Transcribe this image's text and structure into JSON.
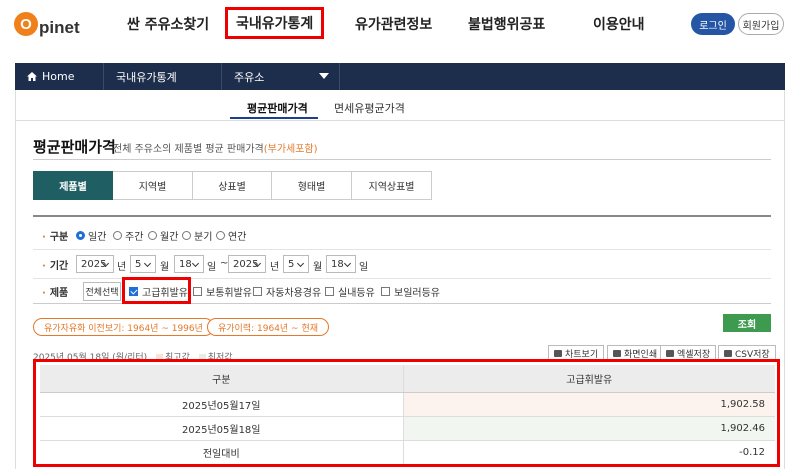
{
  "header": {
    "logo_letter": "O",
    "logo_text": "pinet",
    "nav": [
      "싼 주유소찾기",
      "국내유가통계",
      "유가관련정보",
      "불법행위공표",
      "이용안내"
    ],
    "login": "로그인",
    "join": "회원가입"
  },
  "subbar": {
    "home": "Home",
    "section": "국내유가통계",
    "dropdown": "주유소"
  },
  "subtabs": [
    "평균판매가격",
    "면세유평균가격"
  ],
  "page": {
    "title": "평균판매가격",
    "desc": "전체 주유소의 제품별 평균 판매가격",
    "desc_note": "(부가세포함)"
  },
  "tabs": [
    "제품별",
    "지역별",
    "상표별",
    "형태별",
    "지역상표별"
  ],
  "filters": {
    "period_label": "구분",
    "period_options": [
      "일간",
      "주간",
      "월간",
      "분기",
      "연간"
    ],
    "period_selected": "일간",
    "range_label": "기간",
    "from": {
      "year": "2025",
      "month": "5",
      "day": "18"
    },
    "to": {
      "year": "2025",
      "month": "5",
      "day": "18"
    },
    "unit_year": "년",
    "unit_month": "월",
    "unit_day": "일",
    "tilde": "~",
    "product_label": "제품",
    "select_all": "전체선택",
    "products": [
      {
        "name": "고급휘발유",
        "checked": true
      },
      {
        "name": "보통휘발유",
        "checked": false
      },
      {
        "name": "자동차용경유",
        "checked": false
      },
      {
        "name": "실내등유",
        "checked": false
      },
      {
        "name": "보일러등유",
        "checked": false
      }
    ]
  },
  "links": {
    "history1": "유가자유화 이전보기: 1964년 ~ 1996년",
    "history2": "유가이력: 1964년 ~ 현재"
  },
  "search_button": "조회",
  "meta": {
    "date": "2025년 05월 18일 (원/리터)",
    "legend_high": "최고값",
    "legend_low": "최저값"
  },
  "actions": [
    "차트보기",
    "화면인쇄",
    "엑셀저장",
    "CSV저장"
  ],
  "table": {
    "headers": [
      "구분",
      "고급휘발유"
    ],
    "rows": [
      {
        "label": "2025년05월17일",
        "value": "1,902.58"
      },
      {
        "label": "2025년05월18일",
        "value": "1,902.46"
      },
      {
        "label": "전일대비",
        "value": "-0.12"
      }
    ]
  },
  "colors": {
    "brand_orange": "#f0801a",
    "navy": "#1d2d4c",
    "tab_active": "#1f5f63",
    "highlight_red": "#ee0000",
    "search_green": "#3d9a4f"
  }
}
